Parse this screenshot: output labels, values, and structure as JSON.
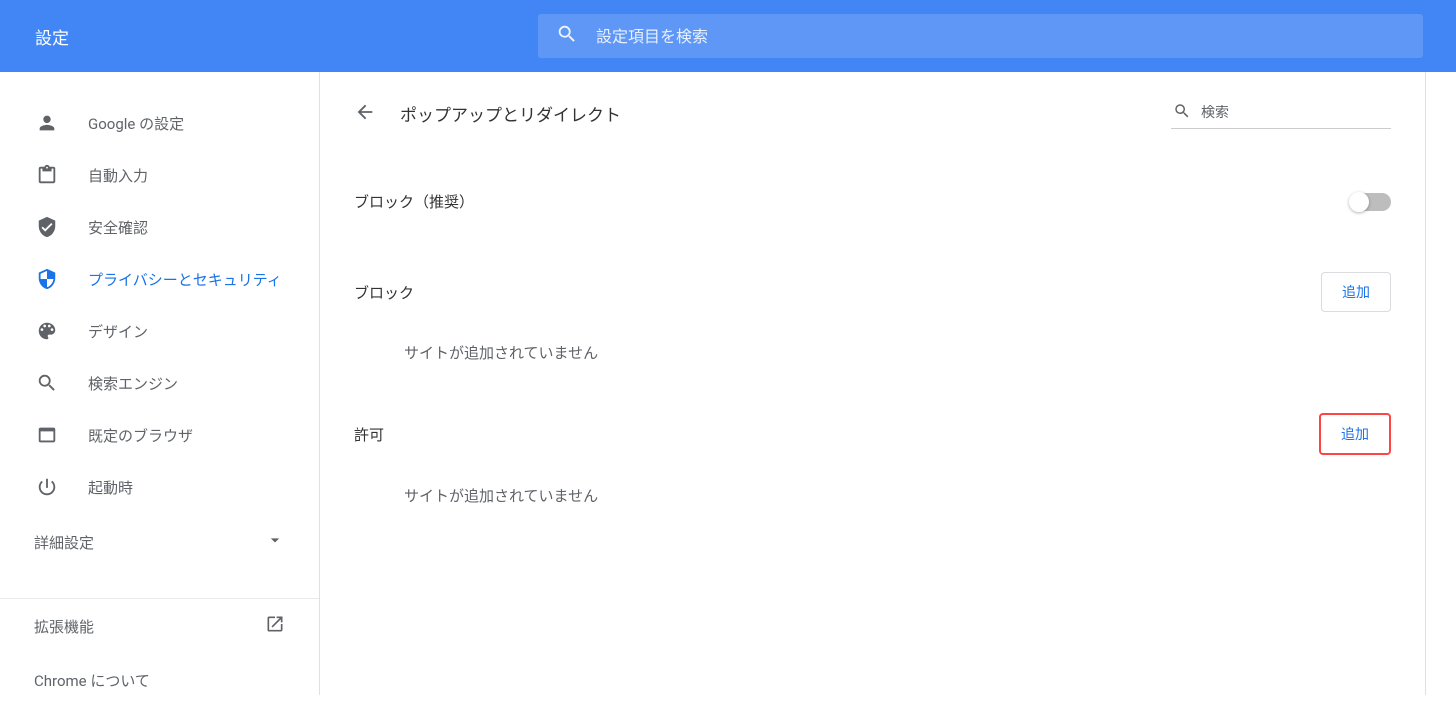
{
  "header": {
    "title": "設定",
    "search_placeholder": "設定項目を検索"
  },
  "sidebar": {
    "items": [
      {
        "label": "Google の設定"
      },
      {
        "label": "自動入力"
      },
      {
        "label": "安全確認"
      },
      {
        "label": "プライバシーとセキュリティ"
      },
      {
        "label": "デザイン"
      },
      {
        "label": "検索エンジン"
      },
      {
        "label": "既定のブラウザ"
      },
      {
        "label": "起動時"
      }
    ],
    "advanced_label": "詳細設定",
    "extensions_label": "拡張機能",
    "about_label": "Chrome について"
  },
  "content": {
    "page_title": "ポップアップとリダイレクト",
    "mini_search_placeholder": "検索",
    "block_recommended_label": "ブロック（推奨）",
    "block_section": {
      "title": "ブロック",
      "add_button": "追加",
      "empty_message": "サイトが追加されていません"
    },
    "allow_section": {
      "title": "許可",
      "add_button": "追加",
      "empty_message": "サイトが追加されていません"
    }
  }
}
